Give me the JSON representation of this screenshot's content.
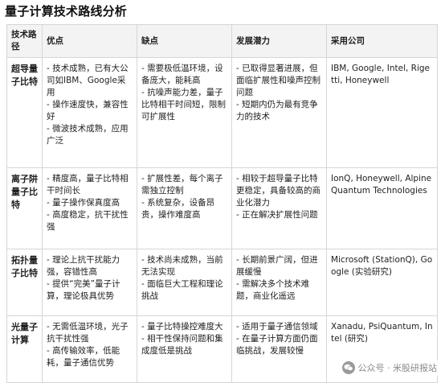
{
  "title": "量子计算技术路线分析",
  "table": {
    "headers": [
      "技术路径",
      "优点",
      "缺点",
      "发展潜力",
      "采用公司"
    ],
    "rows": [
      {
        "route": "超导量子比特",
        "pros": [
          "- 技术成熟，已有大公司如IBM、Google采用",
          "- 操作速度快，兼容性好",
          "- 微波技术成熟，应用广泛"
        ],
        "cons": [
          "- 需要极低温环境，设备庞大，能耗高",
          "- 抗噪声能力差，量子比特相干时间短，限制可扩展性"
        ],
        "potential": [
          "- 已取得显著进展，但面临扩展性和噪声控制问题",
          "- 短期内仍为最有竞争力的技术"
        ],
        "companies": "IBM, Google, Intel, Rigetti, Honeywell"
      },
      {
        "route": "离子阱量子比特",
        "pros": [
          "- 精度高，量子比特相干时间长",
          "- 量子操作保真度高",
          "- 高度稳定，抗干扰性强"
        ],
        "cons": [
          "- 扩展性差，每个离子需独立控制",
          "- 系统复杂，设备昂贵，操作难度高"
        ],
        "potential": [
          "- 相较于超导量子比特更稳定，具备较高的商业化潜力",
          "- 正在解决扩展性问题"
        ],
        "companies": "IonQ, Honeywell, Alpine Quantum Technologies"
      },
      {
        "route": "拓扑量子比特",
        "pros": [
          "- 理论上抗干扰能力强，容错性高",
          "- 提供“完美”量子计算，理论极具优势"
        ],
        "cons": [
          "- 技术尚未成熟，当前无法实现",
          "- 面临巨大工程和理论挑战"
        ],
        "potential": [
          "- 长期前景广阔，但进展缓慢",
          "- 需解决多个技术难题，商业化遥远"
        ],
        "companies": "Microsoft (StationQ), Google (实验研究)"
      },
      {
        "route": "光量子计算",
        "pros": [
          "- 无需低温环境，光子抗干扰性强",
          "- 高传输效率，低能耗，量子通信优势"
        ],
        "cons": [
          "- 量子比特操控难度大",
          "- 相干性保持问题和集成度低是挑战"
        ],
        "potential": [
          "- 适用于量子通信领域",
          "- 在量子计算方面仍面临挑战，发展较慢"
        ],
        "companies": "Xanadu, PsiQuantum, Intel (研究)"
      }
    ]
  },
  "watermark": {
    "text": "公众号 · 米股研报站",
    "icon": "wechat-icon"
  }
}
